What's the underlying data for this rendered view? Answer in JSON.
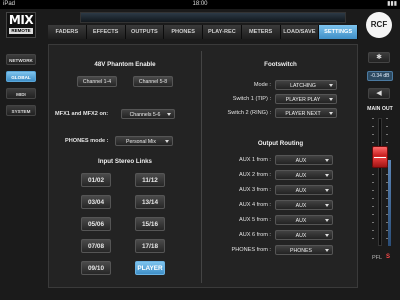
{
  "status": {
    "device": "iPad",
    "time": "18:00"
  },
  "logo": {
    "main": "MIX",
    "sub": "REMOTE"
  },
  "rcf_logo": "RCF",
  "tabs": [
    "FADERS",
    "EFFECTS",
    "OUTPUTS",
    "PHONES",
    "PLAY-REC",
    "METERS",
    "LOAD/SAVE",
    "SETTINGS"
  ],
  "active_tab": "SETTINGS",
  "nav": [
    "NETWORK",
    "GLOBAL",
    "MIDI",
    "SYSTEM"
  ],
  "active_nav": "GLOBAL",
  "phantom": {
    "title": "48V Phantom Enable",
    "ch1": "Channel 1-4",
    "ch2": "Channel 5-8"
  },
  "mfx": {
    "label": "MFX1 and MFX2 on:",
    "value": "Channels 5-6"
  },
  "phones_mode": {
    "label": "PHONES mode :",
    "value": "Personal Mix"
  },
  "stereo_links": {
    "title": "Input Stereo Links",
    "buttons": [
      "01/02",
      "11/12",
      "03/04",
      "13/14",
      "05/06",
      "15/16",
      "07/08",
      "17/18",
      "09/10",
      "PLAYER"
    ]
  },
  "footswitch": {
    "title": "Footswitch",
    "mode_label": "Mode :",
    "mode_value": "LATCHING",
    "sw1_label": "Switch 1 (TIP) :",
    "sw1_value": "PLAYER PLAY",
    "sw2_label": "Switch 2 (RING) :",
    "sw2_value": "PLAYER NEXT"
  },
  "output_routing": {
    "title": "Output Routing",
    "rows": [
      {
        "label": "AUX 1 from :",
        "value": "AUX"
      },
      {
        "label": "AUX 2 from :",
        "value": "AUX"
      },
      {
        "label": "AUX 3 from :",
        "value": "AUX"
      },
      {
        "label": "AUX 4 from :",
        "value": "AUX"
      },
      {
        "label": "AUX 5 from :",
        "value": "AUX"
      },
      {
        "label": "AUX 6 from :",
        "value": "AUX"
      },
      {
        "label": "PHONES from :",
        "value": "PHONES"
      }
    ]
  },
  "main_out": {
    "gain": "-0.34 dB",
    "label": "MAIN OUT",
    "pfl": "PFL",
    "solo": "S"
  },
  "colors": {
    "accent": "#5aa6d8",
    "fader": "#d42a2a"
  }
}
